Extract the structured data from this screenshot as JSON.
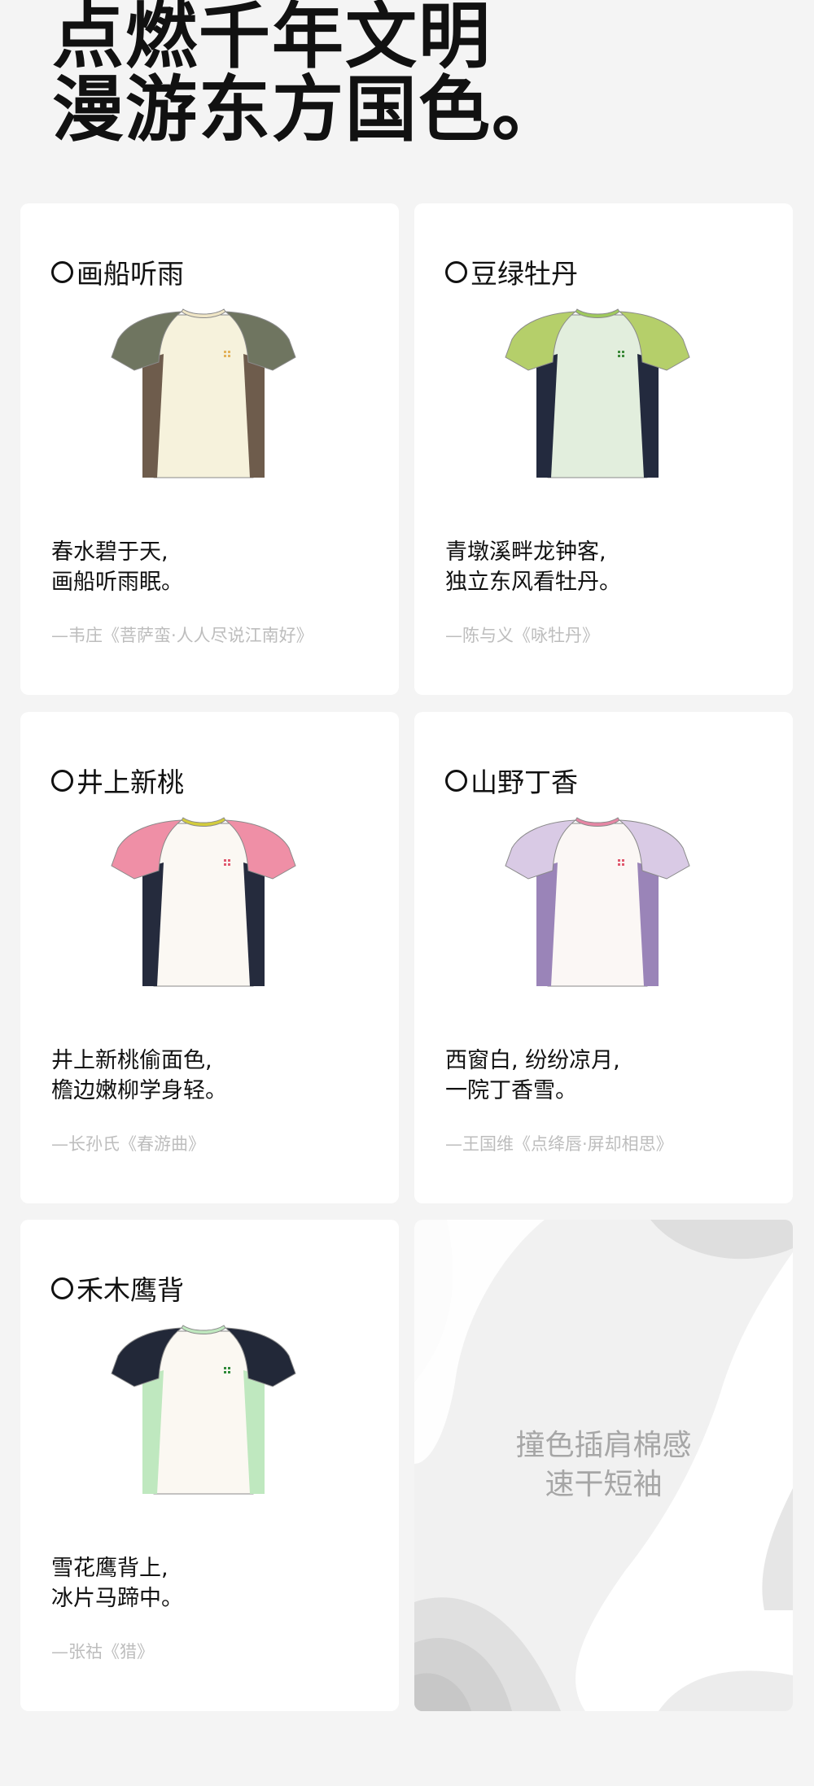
{
  "headline": {
    "line1": "点燃千年文明",
    "line2": "漫游东方国色。"
  },
  "cards": [
    {
      "title": "画船听雨",
      "poem_line1": "春水碧于天,",
      "poem_line2": "画船听雨眠。",
      "source": "—韦庄《菩萨蛮·人人尽说江南好》",
      "colors": {
        "body": "#f6f2dc",
        "sleeve": "#6f7560",
        "side": "#6e5c4c",
        "collar": "#f0e6c6",
        "logo": "#e3b25a"
      }
    },
    {
      "title": "豆绿牡丹",
      "poem_line1": "青墩溪畔龙钟客,",
      "poem_line2": "独立东风看牡丹。",
      "source": "—陈与义《咏牡丹》",
      "colors": {
        "body": "#e2eedd",
        "sleeve": "#b5cf6a",
        "side": "#232a3e",
        "collar": "#9fca5c",
        "logo": "#3d8a3a"
      }
    },
    {
      "title": "井上新桃",
      "poem_line1": "井上新桃偷面色,",
      "poem_line2": "檐边嫩柳学身轻。",
      "source": "—长孙氏《春游曲》",
      "colors": {
        "body": "#fbf8f3",
        "sleeve": "#ef8fa6",
        "side": "#252b3d",
        "collar": "#d3cc3c",
        "logo": "#e0586e"
      }
    },
    {
      "title": "山野丁香",
      "poem_line1": "西窗白, 纷纷凉月,",
      "poem_line2": "一院丁香雪。",
      "source": "—王国维《点绛唇·屏却相思》",
      "colors": {
        "body": "#fbf7f5",
        "sleeve": "#d9cae5",
        "side": "#9a84b8",
        "collar": "#e686a4",
        "logo": "#e0586e"
      }
    },
    {
      "title": "禾木鹰背",
      "poem_line1": "雪花鹰背上,",
      "poem_line2": "冰片马蹄中。",
      "source": "—张祜《猎》",
      "colors": {
        "body": "#fbf8f2",
        "sleeve": "#222838",
        "side": "#bfe8bf",
        "collar": "#bfe8bf",
        "logo": "#2f8a3a"
      }
    }
  ],
  "feature": {
    "line1": "撞色插肩棉感",
    "line2": "速干短袖"
  }
}
